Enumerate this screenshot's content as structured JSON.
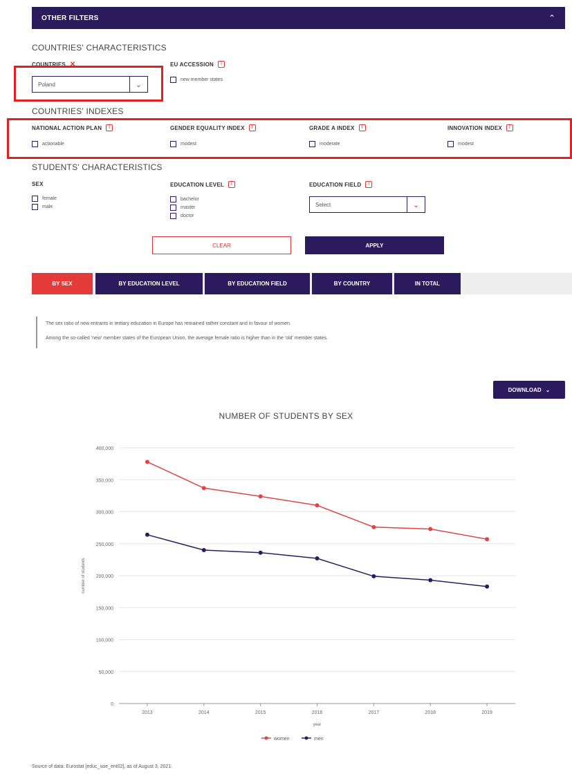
{
  "filters": {
    "title": "OTHER FILTERS",
    "collapse_glyph": "⌃"
  },
  "countries_characteristics": {
    "title": "COUNTRIES' CHARACTERISTICS",
    "country": {
      "label": "COUNTRIES",
      "selected": "Poland"
    },
    "eu_accession": {
      "label": "EU ACCESSION",
      "option": "new member states"
    }
  },
  "countries_indexes": {
    "title": "COUNTRIES' INDEXES",
    "items": [
      {
        "label": "NATIONAL ACTION PLAN",
        "option": "actionable"
      },
      {
        "label": "GENDER EQUALITY INDEX",
        "option": "modest"
      },
      {
        "label": "GRADE A INDEX",
        "option": "moderate"
      },
      {
        "label": "INNOVATION INDEX",
        "option": "modest"
      }
    ]
  },
  "students_characteristics": {
    "title": "STUDENTS' CHARACTERISTICS",
    "sex": {
      "label": "SEX",
      "options": [
        "female",
        "male"
      ]
    },
    "education_level": {
      "label": "EDUCATION LEVEL",
      "options": [
        "bachelor",
        "master",
        "doctor"
      ]
    },
    "education_field": {
      "label": "EDUCATION FIELD",
      "selected": "Select"
    }
  },
  "buttons": {
    "clear": "CLEAR",
    "apply": "APPLY",
    "download": "DOWNLOAD"
  },
  "tabs": [
    "BY SEX",
    "BY EDUCATION LEVEL",
    "BY EDUCATION FIELD",
    "BY COUNTRY",
    "IN TOTAL"
  ],
  "note": {
    "line1": "The sex ratio of new entrants in tertiary education in Europe has remained rather constant and in favour of women.",
    "line2": "Among the so-called 'new' member states of the European Union, the average female ratio is higher than in the 'old' member states."
  },
  "source": "Source of data: Eurostat [educ_uoe_ent02], as of August 3, 2021.",
  "colors": {
    "primary": "#2b1b5e",
    "accent": "#e43a3a",
    "women": "#e04545",
    "men": "#2b1b5e"
  },
  "chart_data": {
    "type": "line",
    "title": "NUMBER OF STUDENTS BY SEX",
    "xlabel": "year",
    "ylabel": "number of students",
    "x": [
      "2013",
      "2014",
      "2015",
      "2016",
      "2017",
      "2018",
      "2019"
    ],
    "ylim": [
      0,
      400000
    ],
    "yticks": [
      "0",
      "50,000",
      "100,000",
      "150,000",
      "200,000",
      "250,000",
      "300,000",
      "350,000",
      "400,000"
    ],
    "grid": true,
    "legend": "bottom",
    "series": [
      {
        "name": "women",
        "values": [
          378000,
          337000,
          324000,
          310000,
          276000,
          273000,
          257000
        ]
      },
      {
        "name": "men",
        "values": [
          264000,
          240000,
          236000,
          227000,
          199000,
          193000,
          183000
        ]
      }
    ]
  }
}
